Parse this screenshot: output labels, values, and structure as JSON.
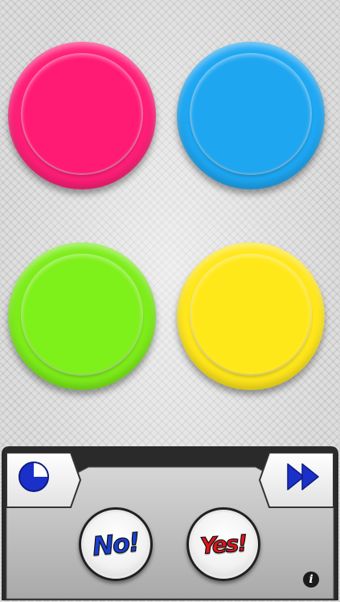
{
  "color_buttons": [
    {
      "id": "pink",
      "color": "#ff1a74"
    },
    {
      "id": "blue",
      "color": "#1fa6f0"
    },
    {
      "id": "green",
      "color": "#7ef01a"
    },
    {
      "id": "yellow",
      "color": "#ffe81a"
    }
  ],
  "controls": {
    "timer_icon": "pie-clock-icon",
    "skip_icon": "fast-forward-icon",
    "no_label": "No!",
    "yes_label": "Yes!",
    "no_color": "#1a3fd0",
    "yes_color": "#e0141b",
    "info_label": "i"
  },
  "theme": {
    "panel_color": "#c9c9c9",
    "accent_blue": "#1b30c8"
  }
}
